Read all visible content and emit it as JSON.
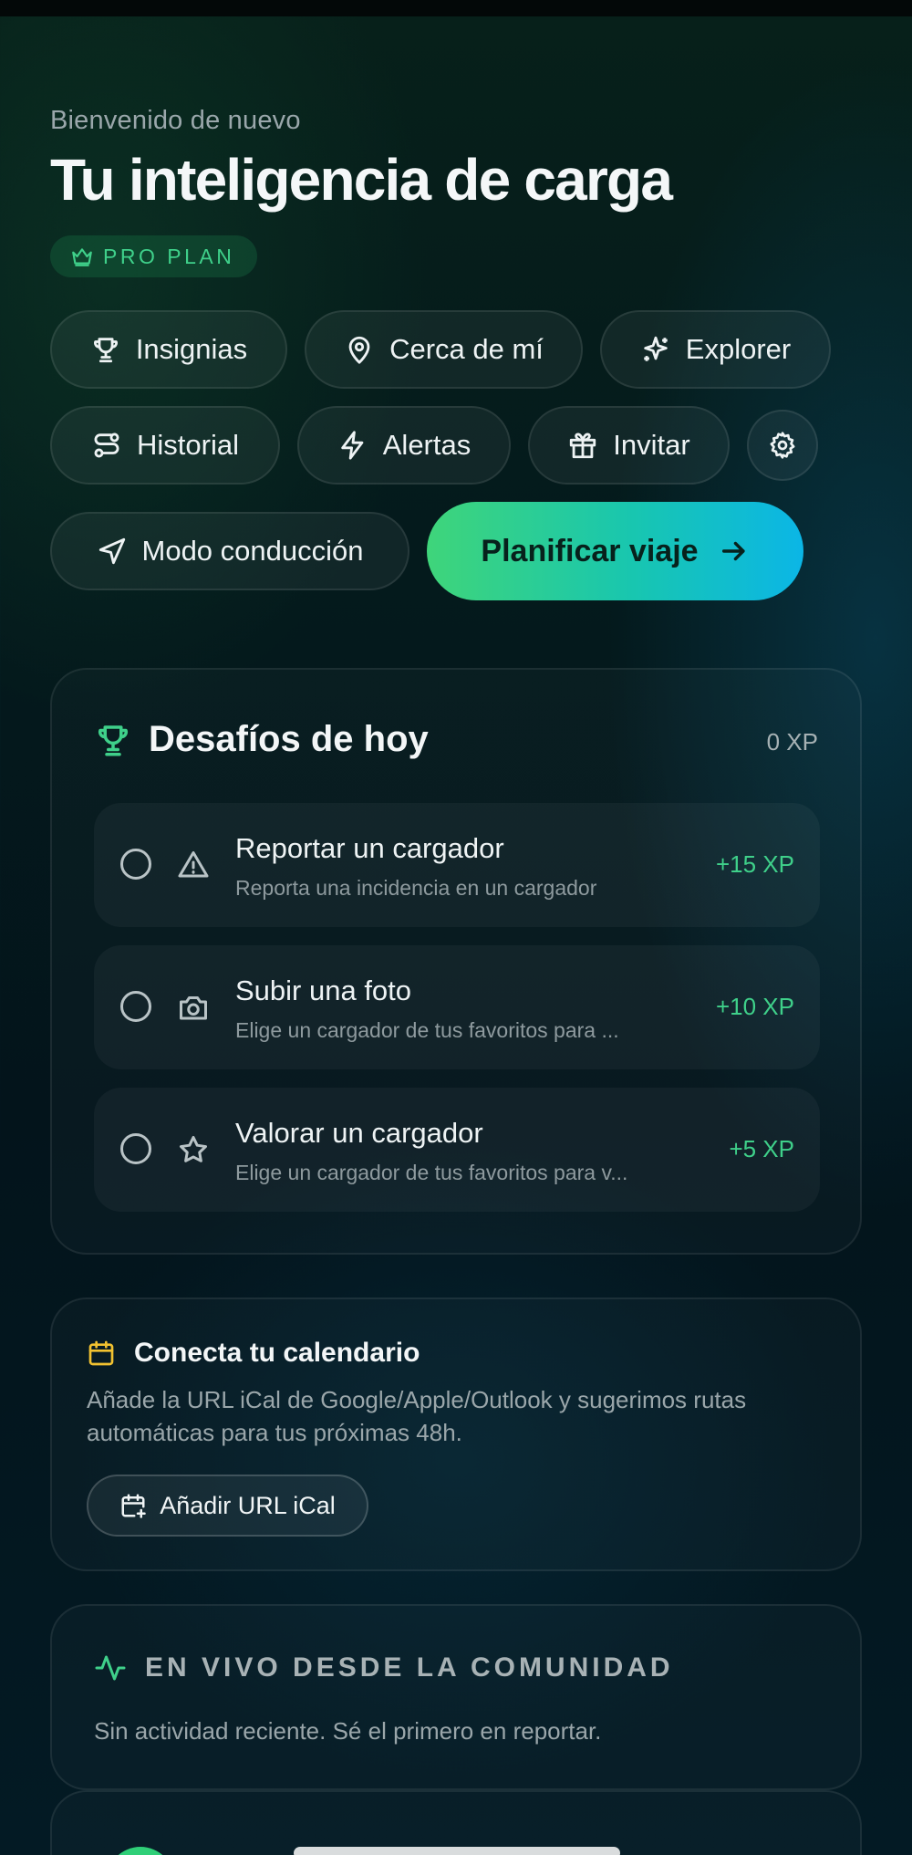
{
  "header": {
    "welcome": "Bienvenido de nuevo",
    "title": "Tu inteligencia de carga",
    "plan_badge": "PRO PLAN"
  },
  "actions": {
    "badges": "Insignias",
    "nearby": "Cerca de mí",
    "explorer": "Explorer",
    "history": "Historial",
    "alerts": "Alertas",
    "invite": "Invitar",
    "settings_icon": "gear-icon",
    "driving_mode": "Modo conducción",
    "plan_trip": "Planificar viaje"
  },
  "challenges": {
    "title": "Desafíos de hoy",
    "xp_total": "0 XP",
    "items": [
      {
        "name": "Reportar un cargador",
        "desc": "Reporta una incidencia en un cargador",
        "points": "+15 XP",
        "icon": "warning-icon"
      },
      {
        "name": "Subir una foto",
        "desc": "Elige un cargador de tus favoritos para ...",
        "points": "+10 XP",
        "icon": "camera-icon"
      },
      {
        "name": "Valorar un cargador",
        "desc": "Elige un cargador de tus favoritos para v...",
        "points": "+5 XP",
        "icon": "star-icon"
      }
    ]
  },
  "calendar": {
    "title": "Conecta tu calendario",
    "desc": "Añade la URL iCal de Google/Apple/Outlook y sugerimos rutas automáticas para tus próximas 48h.",
    "button": "Añadir URL iCal"
  },
  "community": {
    "title": "EN VIVO DESDE LA COMUNIDAD",
    "empty": "Sin actividad reciente. Sé el primero en reportar."
  },
  "colors": {
    "accent_green": "#3fd08a",
    "cta_gradient_start": "#3fd57a",
    "cta_gradient_end": "#0bb6e6",
    "calendar_icon": "#f2c230"
  }
}
